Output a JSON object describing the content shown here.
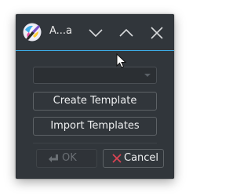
{
  "window": {
    "title": "A...a",
    "app_icon": "krita-brush-icon"
  },
  "titlebar_buttons": {
    "minimize_icon": "chevron-down-icon",
    "maximize_icon": "chevron-up-icon",
    "close_icon": "close-icon"
  },
  "template_combo": {
    "value": ""
  },
  "buttons": {
    "create_template": "Create Template",
    "import_templates": "Import Templates",
    "ok": "OK",
    "cancel": "Cancel"
  },
  "colors": {
    "background": "#31363b",
    "accent": "#3daee9",
    "text": "#eff0f1",
    "disabled_text": "#6b7075",
    "cancel_icon": "#da4453"
  }
}
